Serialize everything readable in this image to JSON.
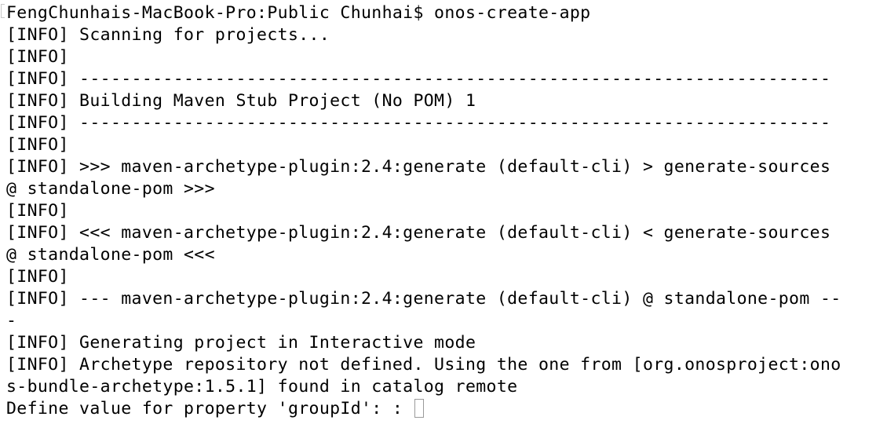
{
  "terminal": {
    "lines": [
      "FengChunhais-MacBook-Pro:Public Chunhai$ onos-create-app",
      "[INFO] Scanning for projects...",
      "[INFO]",
      "[INFO] ------------------------------------------------------------------------",
      "[INFO] Building Maven Stub Project (No POM) 1",
      "[INFO] ------------------------------------------------------------------------",
      "[INFO]",
      "[INFO] >>> maven-archetype-plugin:2.4:generate (default-cli) > generate-sources",
      "@ standalone-pom >>>",
      "[INFO]",
      "[INFO] <<< maven-archetype-plugin:2.4:generate (default-cli) < generate-sources",
      "@ standalone-pom <<<",
      "[INFO]",
      "[INFO] --- maven-archetype-plugin:2.4:generate (default-cli) @ standalone-pom --",
      "-",
      "[INFO] Generating project in Interactive mode",
      "[INFO] Archetype repository not defined. Using the one from [org.onosproject:ono",
      "s-bundle-archetype:1.5.1] found in catalog remote"
    ],
    "prompt_line": "Define value for property 'groupId': : ",
    "colors": {
      "background": "#ffffff",
      "text": "#000000",
      "cursor_border": "#9a9a9a"
    }
  }
}
